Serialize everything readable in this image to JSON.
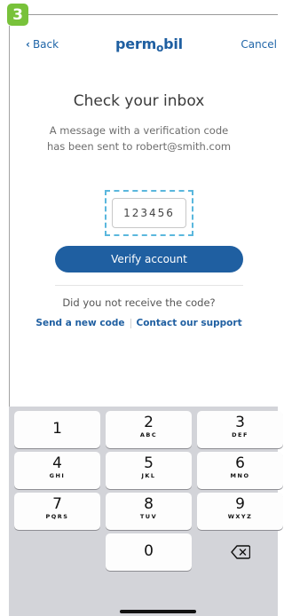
{
  "annotation": {
    "step_number": "3"
  },
  "nav": {
    "back_label": "Back",
    "brand": "permobil",
    "cancel_label": "Cancel"
  },
  "content": {
    "heading": "Check your inbox",
    "message_line1": "A message with a verification code",
    "message_line2": "has been sent to robert@smith.com",
    "code_value": "123456",
    "verify_button": "Verify account",
    "question": "Did you not receive the code?",
    "send_new_code": "Send a new code",
    "contact_support": "Contact our support"
  },
  "keyboard": {
    "keys": [
      {
        "digit": "1",
        "letters": ""
      },
      {
        "digit": "2",
        "letters": "ABC"
      },
      {
        "digit": "3",
        "letters": "DEF"
      },
      {
        "digit": "4",
        "letters": "GHI"
      },
      {
        "digit": "5",
        "letters": "JKL"
      },
      {
        "digit": "6",
        "letters": "MNO"
      },
      {
        "digit": "7",
        "letters": "PQRS"
      },
      {
        "digit": "8",
        "letters": "TUV"
      },
      {
        "digit": "9",
        "letters": "WXYZ"
      },
      {
        "digit": "0",
        "letters": ""
      }
    ],
    "backspace_icon": "delete-backspace-icon"
  },
  "colors": {
    "brand": "#1f5fa1",
    "link": "#1f65a8",
    "badge": "#78c23a",
    "highlight": "#5ab7dd",
    "keyboard_bg": "#d3d4d9"
  }
}
